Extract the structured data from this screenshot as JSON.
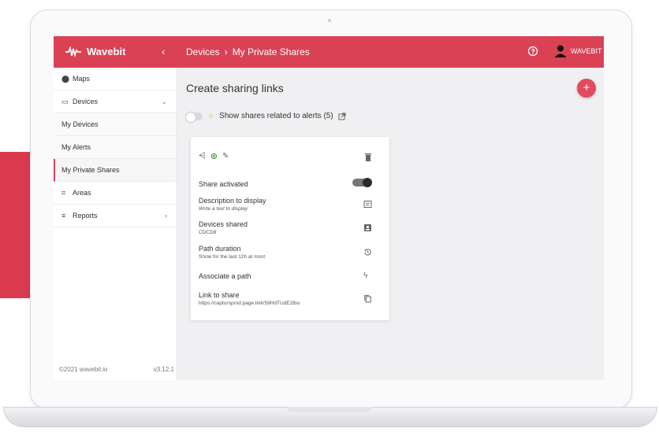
{
  "header": {
    "brand": "Wavebit",
    "collapse_label": "‹",
    "breadcrumb_section": "Devices",
    "breadcrumb_separator": "›",
    "breadcrumb_page": "My Private Shares",
    "user_name": "WAVEBIT"
  },
  "sidebar": {
    "items": [
      {
        "label": "Maps",
        "icon": "pin-icon"
      },
      {
        "label": "Devices",
        "icon": "device-icon"
      },
      {
        "label": "My Devices"
      },
      {
        "label": "My Alerts"
      },
      {
        "label": "My Private Shares"
      },
      {
        "label": "Areas",
        "icon": "area-icon"
      },
      {
        "label": "Reports",
        "icon": "list-icon"
      }
    ],
    "copyright": "©2021 wavebit.io",
    "version": "v3.12.1"
  },
  "main": {
    "title": "Create sharing links",
    "add_label": "+",
    "alerts_toggle_label": "Show shares related to alerts (5)"
  },
  "share_card": {
    "activated_label": "Share activated",
    "description_title": "Description to display",
    "description_placeholder": "Write a text to display",
    "devices_title": "Devices shared",
    "devices_value": "CDCD8",
    "duration_title": "Path duration",
    "duration_value": "Show for the last 12h at most",
    "associate_label": "Associate a path",
    "link_title": "Link to share",
    "link_value": "https://captursprod.page.link/59HdTUdE2tbo"
  },
  "colors": {
    "brand_red": "#db4155",
    "fab_red": "#e24b5e"
  }
}
